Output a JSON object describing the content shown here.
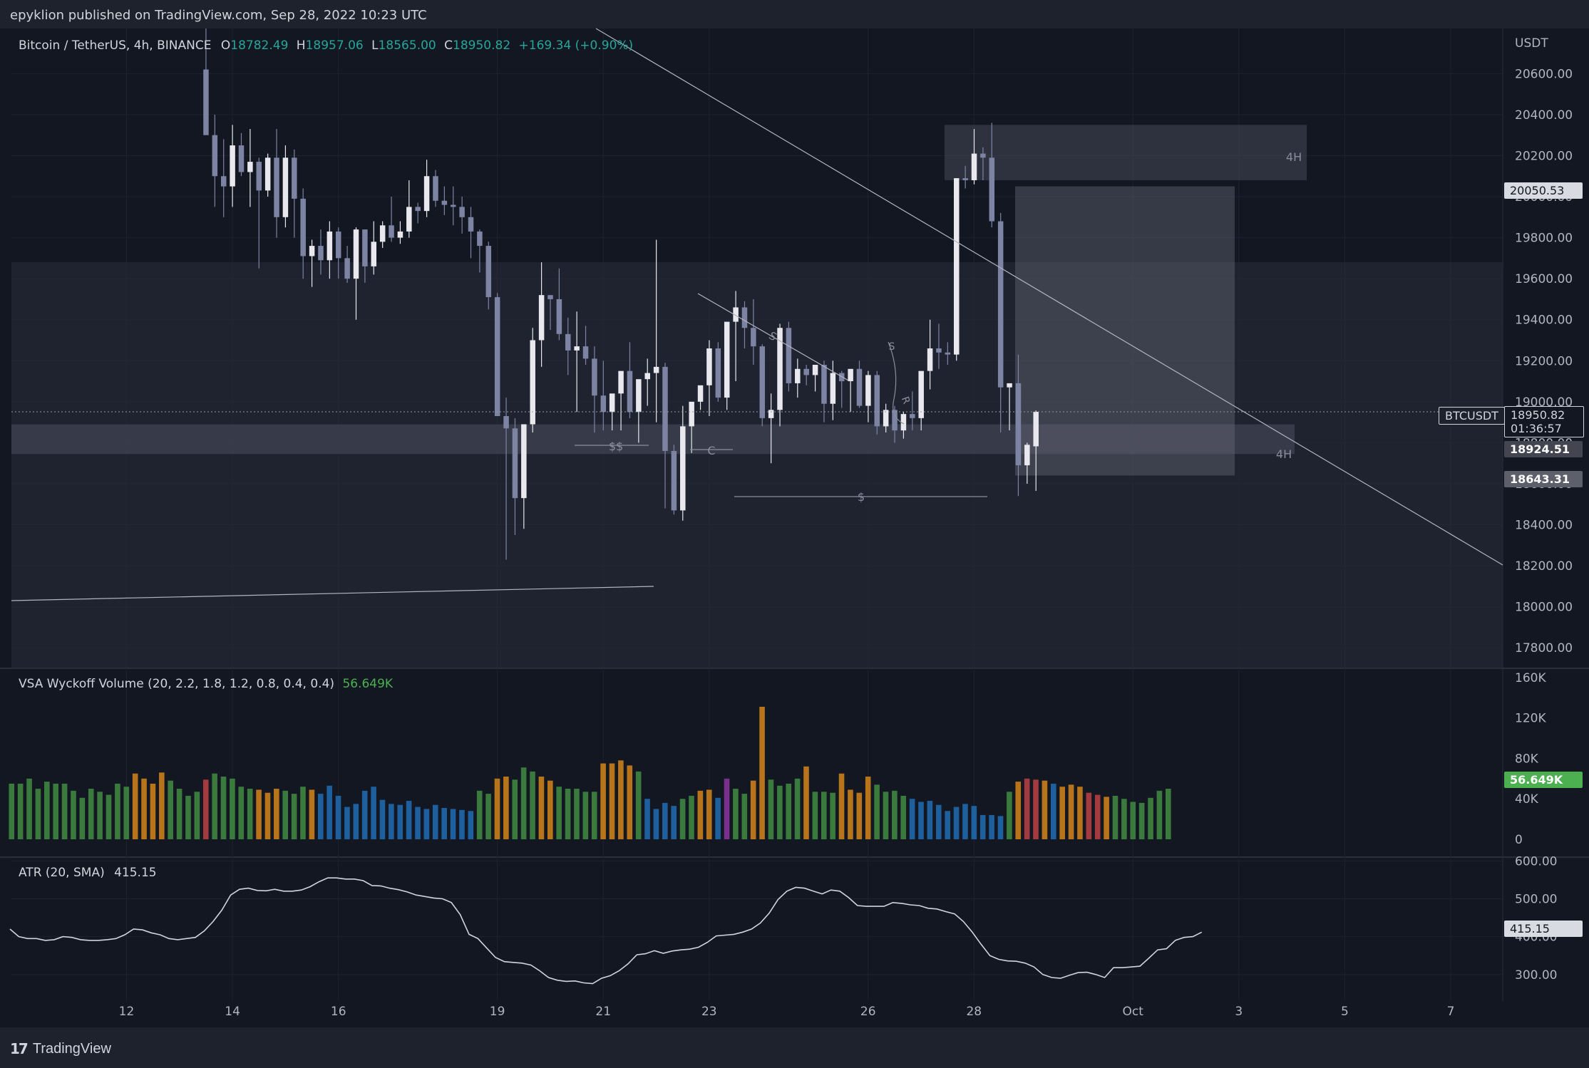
{
  "header": {
    "publisher": "epyklion published on TradingView.com, Sep 28, 2022 10:23 UTC"
  },
  "footer": {
    "brand": "TradingView",
    "logo_icon": "tradingview-logo-icon"
  },
  "legend": {
    "symbol": "Bitcoin / TetherUS, 4h, BINANCE",
    "open_label": "O",
    "open": "18782.49",
    "high_label": "H",
    "high": "18957.06",
    "low_label": "L",
    "low": "18565.00",
    "close_label": "C",
    "close": "18950.82",
    "change": "+169.34 (+0.90%)",
    "volume_title": "VSA Wyckoff Volume (20, 2.2, 1.8, 1.2, 0.8, 0.4, 0.4)",
    "volume_value": "56.649K",
    "atr_title": "ATR (20, SMA)",
    "atr_value": "415.15"
  },
  "badges": {
    "symbol_tag": "BTCUSDT",
    "last_price": "18950.82",
    "countdown": "01:36:57",
    "level_high": "20050.53",
    "level_mid": "18924.51",
    "level_low": "18643.31",
    "volume_last": "56.649K",
    "atr_last": "415.15"
  },
  "colors": {
    "background": "#131722",
    "up_candle": "#e8e8ee",
    "down_candle": "#7d84a3",
    "vol_green": "#3a7a3c",
    "vol_blue": "#1e5f9e",
    "vol_orange": "#b8741a",
    "vol_red": "#a33a3f",
    "vol_purple": "#7b2f8c",
    "last_price_green": "#4caf50"
  },
  "chart_data": [
    {
      "type": "candlestick",
      "title": "Bitcoin / TetherUS, 4h, BINANCE",
      "ylabel": "USDT",
      "ylim": [
        17700,
        20820
      ],
      "yticks": [
        17800,
        18000,
        18200,
        18400,
        18600,
        18800,
        19000,
        19200,
        19400,
        19600,
        19800,
        20000,
        20200,
        20400,
        20600
      ],
      "ytick_labels": [
        "17800.00",
        "18000.00",
        "18200.00",
        "18400.00",
        "18600.00",
        "18800.00",
        "19000.00",
        "19200.00",
        "19400.00",
        "19600.00",
        "19800.00",
        "20000.00",
        "20200.00",
        "20400.00",
        "20600.00"
      ],
      "x_axis": {
        "day_ticks": [
          {
            "day": 12,
            "label": "12"
          },
          {
            "day": 14,
            "label": "14"
          },
          {
            "day": 16,
            "label": "16"
          },
          {
            "day": 19,
            "label": "19"
          },
          {
            "day": 21,
            "label": "21"
          },
          {
            "day": 23,
            "label": "23"
          },
          {
            "day": 26,
            "label": "26"
          },
          {
            "day": 28,
            "label": "28"
          },
          {
            "day": 31,
            "label": "Oct"
          },
          {
            "day": 33,
            "label": "3"
          },
          {
            "day": 35,
            "label": "5"
          },
          {
            "day": 37,
            "label": "7"
          }
        ],
        "visible_range_days": [
          9.8,
          38.4
        ],
        "bar_interval_days": 0.1667
      },
      "first_bar_day": 13.5,
      "ohlc": [
        [
          20620,
          20820,
          20600,
          20300
        ],
        [
          20300,
          20400,
          19950,
          20100
        ],
        [
          20100,
          20280,
          19900,
          20050
        ],
        [
          20050,
          20350,
          19950,
          20250
        ],
        [
          20250,
          20310,
          20100,
          20120
        ],
        [
          20120,
          20330,
          19950,
          20170
        ],
        [
          20170,
          20190,
          19650,
          20030
        ],
        [
          20030,
          20210,
          20000,
          20190
        ],
        [
          20190,
          20330,
          19800,
          19900
        ],
        [
          19900,
          20250,
          19850,
          20190
        ],
        [
          20190,
          20230,
          19800,
          19990
        ],
        [
          19990,
          20040,
          19600,
          19710
        ],
        [
          19710,
          19790,
          19560,
          19760
        ],
        [
          19760,
          19840,
          19620,
          19690
        ],
        [
          19690,
          19880,
          19600,
          19830
        ],
        [
          19830,
          19850,
          19600,
          19700
        ],
        [
          19700,
          19760,
          19580,
          19600
        ],
        [
          19600,
          19850,
          19400,
          19840
        ],
        [
          19840,
          19840,
          19580,
          19660
        ],
        [
          19660,
          19880,
          19620,
          19780
        ],
        [
          19780,
          19880,
          19750,
          19860
        ],
        [
          19860,
          20000,
          19780,
          19800
        ],
        [
          19800,
          19880,
          19770,
          19830
        ],
        [
          19830,
          20080,
          19800,
          19950
        ],
        [
          19950,
          19970,
          19870,
          19930
        ],
        [
          19930,
          20180,
          19900,
          20100
        ],
        [
          20100,
          20130,
          19950,
          19980
        ],
        [
          19980,
          20050,
          19910,
          19960
        ],
        [
          19960,
          20050,
          19860,
          19950
        ],
        [
          19950,
          20000,
          19820,
          19900
        ],
        [
          19900,
          19950,
          19700,
          19830
        ],
        [
          19830,
          19840,
          19630,
          19760
        ],
        [
          19760,
          19780,
          19450,
          19510
        ],
        [
          19510,
          19530,
          18950,
          18930
        ],
        [
          18930,
          19020,
          18230,
          18870
        ],
        [
          18870,
          18920,
          18350,
          18530
        ],
        [
          18530,
          18880,
          18380,
          18890
        ],
        [
          18890,
          19360,
          18850,
          19300
        ],
        [
          19300,
          19680,
          19170,
          19520
        ],
        [
          19520,
          19520,
          19350,
          19500
        ],
        [
          19500,
          19650,
          19300,
          19330
        ],
        [
          19330,
          19410,
          19130,
          19250
        ],
        [
          19250,
          19440,
          18950,
          19270
        ],
        [
          19270,
          19370,
          19180,
          19210
        ],
        [
          19210,
          19270,
          18850,
          19030
        ],
        [
          19030,
          19200,
          18860,
          18950
        ],
        [
          18950,
          19030,
          18860,
          19040
        ],
        [
          19040,
          19050,
          18860,
          19150
        ],
        [
          19150,
          19290,
          18920,
          18950
        ],
        [
          18950,
          19030,
          18800,
          19110
        ],
        [
          19110,
          19210,
          18980,
          19140
        ],
        [
          19140,
          19790,
          18900,
          19170
        ],
        [
          19170,
          19190,
          18480,
          18760
        ],
        [
          18760,
          18790,
          18450,
          18470
        ],
        [
          18470,
          18980,
          18420,
          18880
        ],
        [
          18880,
          18990,
          18750,
          19000
        ],
        [
          19000,
          19040,
          18960,
          19080
        ],
        [
          19080,
          19300,
          18930,
          19260
        ],
        [
          19260,
          19290,
          19000,
          19020
        ],
        [
          19020,
          19330,
          18960,
          19390
        ],
        [
          19390,
          19540,
          19100,
          19460
        ],
        [
          19460,
          19490,
          19260,
          19360
        ],
        [
          19360,
          19500,
          19180,
          19270
        ],
        [
          19270,
          19280,
          18880,
          18920
        ],
        [
          18920,
          19040,
          18700,
          18960
        ],
        [
          18960,
          19380,
          18880,
          19360
        ],
        [
          19360,
          19390,
          19050,
          19090
        ],
        [
          19090,
          19210,
          19020,
          19160
        ],
        [
          19160,
          19180,
          19080,
          19130
        ],
        [
          19130,
          19180,
          19050,
          19180
        ],
        [
          19180,
          19200,
          18900,
          18990
        ],
        [
          18990,
          19200,
          18910,
          19140
        ],
        [
          19140,
          19150,
          18970,
          19100
        ],
        [
          19100,
          19150,
          18950,
          19160
        ],
        [
          19160,
          19200,
          18970,
          18980
        ],
        [
          18980,
          19150,
          18900,
          19130
        ],
        [
          19130,
          19150,
          18840,
          18880
        ],
        [
          18880,
          18990,
          18850,
          18960
        ],
        [
          18960,
          18980,
          18800,
          18860
        ],
        [
          18860,
          18950,
          18820,
          18940
        ],
        [
          18940,
          19050,
          18860,
          18920
        ],
        [
          18920,
          19060,
          18860,
          19150
        ],
        [
          19150,
          19400,
          19060,
          19260
        ],
        [
          19260,
          19380,
          19160,
          19240
        ],
        [
          19240,
          19290,
          19180,
          19230
        ],
        [
          19230,
          20090,
          19200,
          20090
        ],
        [
          20090,
          20150,
          20040,
          20080
        ],
        [
          20080,
          20330,
          20060,
          20210
        ],
        [
          20210,
          20240,
          20080,
          20190
        ],
        [
          20190,
          20360,
          19850,
          19880
        ],
        [
          19880,
          19920,
          18850,
          19070
        ],
        [
          19070,
          19090,
          18860,
          19090
        ],
        [
          19090,
          19230,
          18540,
          18690
        ],
        [
          18690,
          18800,
          18600,
          18790
        ],
        [
          18782.49,
          18957.06,
          18565.0,
          18950.82
        ]
      ]
    },
    {
      "type": "bar",
      "title": "VSA Wyckoff Volume (20, 2.2, 1.8, 1.2, 0.8, 0.4, 0.4)",
      "ylim": [
        0,
        162
      ],
      "yticks": [
        0,
        40,
        80,
        120,
        160
      ],
      "ytick_labels": [
        "0",
        "40K",
        "80K",
        "120K",
        "160K"
      ],
      "unit": "K",
      "first_bar_day": 9.83,
      "values": [
        55,
        55,
        60,
        50,
        57,
        55,
        55,
        48,
        41,
        50,
        47,
        44,
        55,
        52,
        65,
        60,
        55,
        66,
        58,
        50,
        43,
        47,
        59,
        65,
        62,
        60,
        52,
        50,
        49,
        46,
        50,
        48,
        45,
        52,
        49,
        45,
        53,
        43,
        32,
        35,
        48,
        52,
        39,
        35,
        34,
        38,
        32,
        30,
        34,
        31,
        30,
        29,
        28,
        48,
        45,
        60,
        62,
        59,
        71,
        67,
        62,
        58,
        52,
        50,
        50,
        47,
        47,
        75,
        75,
        78,
        73,
        67,
        40,
        30,
        36,
        33,
        40,
        43,
        48,
        49,
        41,
        60,
        50,
        45,
        58,
        131,
        59,
        53,
        55,
        60,
        72,
        47,
        47,
        46,
        65,
        49,
        46,
        62,
        54,
        47,
        48,
        43,
        40,
        37,
        38,
        34,
        28,
        32,
        35,
        33,
        24,
        24,
        23,
        47,
        57,
        60,
        59,
        58,
        55,
        52,
        54,
        52,
        46,
        44,
        42,
        43,
        40,
        37,
        36,
        41,
        48,
        50
      ],
      "colors": [
        "g",
        "g",
        "g",
        "g",
        "g",
        "g",
        "g",
        "g",
        "g",
        "g",
        "g",
        "g",
        "g",
        "g",
        "o",
        "o",
        "o",
        "o",
        "g",
        "g",
        "g",
        "g",
        "r",
        "g",
        "g",
        "g",
        "g",
        "g",
        "o",
        "o",
        "o",
        "g",
        "g",
        "g",
        "o",
        "b",
        "b",
        "b",
        "b",
        "b",
        "b",
        "b",
        "b",
        "b",
        "b",
        "b",
        "b",
        "b",
        "b",
        "b",
        "b",
        "b",
        "b",
        "g",
        "g",
        "o",
        "o",
        "g",
        "g",
        "g",
        "o",
        "o",
        "g",
        "g",
        "g",
        "g",
        "g",
        "o",
        "o",
        "o",
        "o",
        "g",
        "b",
        "b",
        "b",
        "b",
        "g",
        "g",
        "o",
        "o",
        "b",
        "p",
        "g",
        "g",
        "o",
        "o",
        "g",
        "g",
        "g",
        "g",
        "o",
        "g",
        "g",
        "g",
        "o",
        "o",
        "o",
        "o",
        "g",
        "g",
        "g",
        "g",
        "b",
        "b",
        "b",
        "b",
        "b",
        "b",
        "b",
        "b",
        "b",
        "b",
        "b",
        "g",
        "o",
        "r",
        "r",
        "o",
        "b",
        "o",
        "o",
        "o",
        "r",
        "r",
        "o",
        "g",
        "g",
        "g",
        "g",
        "g",
        "g",
        "g"
      ]
    },
    {
      "type": "line",
      "title": "ATR (20, SMA)",
      "ylim": [
        230,
        610
      ],
      "yticks": [
        300,
        400,
        500,
        600
      ],
      "ytick_labels": [
        "300.00",
        "400.00",
        "500.00",
        "600.00"
      ],
      "first_point_day": 9.8,
      "points_per_day": 6,
      "values": [
        420,
        400,
        395,
        395,
        390,
        392,
        400,
        398,
        392,
        390,
        390,
        392,
        395,
        405,
        420,
        418,
        410,
        405,
        395,
        392,
        395,
        398,
        415,
        440,
        470,
        510,
        525,
        528,
        522,
        521,
        525,
        520,
        520,
        523,
        532,
        545,
        555,
        555,
        552,
        552,
        548,
        535,
        534,
        528,
        524,
        518,
        510,
        506,
        502,
        500,
        490,
        458,
        406,
        395,
        370,
        345,
        334,
        332,
        330,
        325,
        310,
        292,
        285,
        282,
        283,
        278,
        276,
        290,
        297,
        310,
        328,
        352,
        355,
        363,
        356,
        362,
        365,
        367,
        372,
        385,
        402,
        404,
        406,
        412,
        420,
        436,
        462,
        498,
        520,
        530,
        528,
        520,
        513,
        523,
        520,
        503,
        482,
        480,
        480,
        480,
        490,
        488,
        484,
        482,
        475,
        473,
        466,
        460,
        440,
        412,
        380,
        350,
        340,
        336,
        335,
        330,
        320,
        300,
        292,
        290,
        298,
        305,
        306,
        300,
        292,
        318,
        318,
        320,
        322,
        343,
        365,
        368,
        390,
        398,
        400,
        412
      ]
    }
  ],
  "annotations": {
    "zone_4h_upper": "4H",
    "zone_4h_lower": "4H",
    "label_ss": "$$",
    "label_c": "C",
    "label_s_bottom": "$",
    "label_s_line": "S",
    "label_s_curve": "S",
    "label_r_curve": "R"
  }
}
